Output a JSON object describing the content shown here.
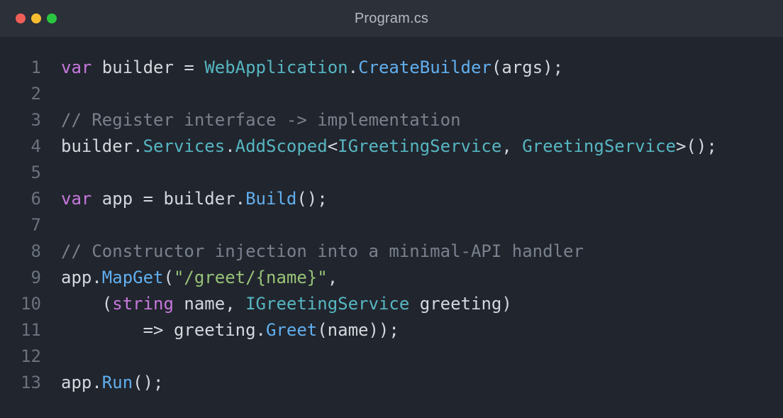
{
  "window": {
    "title": "Program.cs",
    "traffic_lights": {
      "close_color": "#ee5f58",
      "minimize_color": "#f6bd30",
      "maximize_color": "#2bc640"
    }
  },
  "colors": {
    "keyword": "#c678dd",
    "type": "#56b6c2",
    "function": "#61afef",
    "string": "#98c379",
    "comment": "#7a818d",
    "plain": "#d4d7dd",
    "line_number": "#6b727e"
  },
  "lines": [
    {
      "number": "1",
      "tokens": [
        {
          "t": "kw",
          "v": "var"
        },
        {
          "t": "pl",
          "v": " builder = "
        },
        {
          "t": "ty",
          "v": "WebApplication"
        },
        {
          "t": "pl",
          "v": "."
        },
        {
          "t": "fn",
          "v": "CreateBuilder"
        },
        {
          "t": "pl",
          "v": "(args);"
        }
      ]
    },
    {
      "number": "2",
      "tokens": []
    },
    {
      "number": "3",
      "tokens": [
        {
          "t": "cm",
          "v": "// Register interface -> implementation"
        }
      ]
    },
    {
      "number": "4",
      "tokens": [
        {
          "t": "pl",
          "v": "builder."
        },
        {
          "t": "ty",
          "v": "Services"
        },
        {
          "t": "pl",
          "v": "."
        },
        {
          "t": "ty",
          "v": "AddScoped"
        },
        {
          "t": "pl",
          "v": "<"
        },
        {
          "t": "ty",
          "v": "IGreetingService"
        },
        {
          "t": "pl",
          "v": ", "
        },
        {
          "t": "ty",
          "v": "GreetingService"
        },
        {
          "t": "pl",
          "v": ">();"
        }
      ]
    },
    {
      "number": "5",
      "tokens": []
    },
    {
      "number": "6",
      "tokens": [
        {
          "t": "kw",
          "v": "var"
        },
        {
          "t": "pl",
          "v": " app = builder."
        },
        {
          "t": "fn",
          "v": "Build"
        },
        {
          "t": "pl",
          "v": "();"
        }
      ]
    },
    {
      "number": "7",
      "tokens": []
    },
    {
      "number": "8",
      "tokens": [
        {
          "t": "cm",
          "v": "// Constructor injection into a minimal-API handler"
        }
      ]
    },
    {
      "number": "9",
      "tokens": [
        {
          "t": "pl",
          "v": "app."
        },
        {
          "t": "fn",
          "v": "MapGet"
        },
        {
          "t": "pl",
          "v": "("
        },
        {
          "t": "str",
          "v": "\"/greet/{name}\""
        },
        {
          "t": "pl",
          "v": ","
        }
      ]
    },
    {
      "number": "10",
      "tokens": [
        {
          "t": "pl",
          "v": "    ("
        },
        {
          "t": "kw",
          "v": "string"
        },
        {
          "t": "pl",
          "v": " name, "
        },
        {
          "t": "ty",
          "v": "IGreetingService"
        },
        {
          "t": "pl",
          "v": " greeting)"
        }
      ]
    },
    {
      "number": "11",
      "tokens": [
        {
          "t": "pl",
          "v": "        => greeting."
        },
        {
          "t": "fn",
          "v": "Greet"
        },
        {
          "t": "pl",
          "v": "(name));"
        }
      ]
    },
    {
      "number": "12",
      "tokens": []
    },
    {
      "number": "13",
      "tokens": [
        {
          "t": "pl",
          "v": "app."
        },
        {
          "t": "fn",
          "v": "Run"
        },
        {
          "t": "pl",
          "v": "();"
        }
      ]
    }
  ]
}
